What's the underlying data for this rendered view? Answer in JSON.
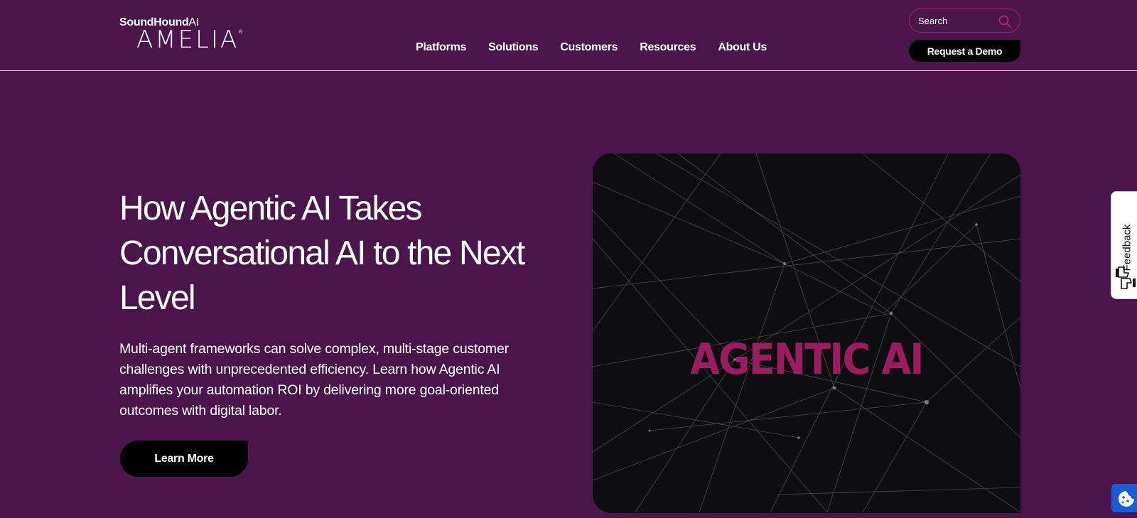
{
  "brand": {
    "company": "SoundHound",
    "company_suffix": "AI",
    "product": "AMELIA",
    "reg_mark": "®"
  },
  "nav": {
    "items": [
      {
        "label": "Platforms"
      },
      {
        "label": "Solutions"
      },
      {
        "label": "Customers"
      },
      {
        "label": "Resources"
      },
      {
        "label": "About Us"
      }
    ]
  },
  "search": {
    "placeholder": "Search",
    "icon": "search-icon"
  },
  "header": {
    "demo_label": "Request a Demo"
  },
  "hero": {
    "title": "How Agentic AI Takes Conversational AI to the Next Level",
    "description": "Multi-agent frameworks can solve complex, multi-stage customer challenges with unprecedented efficiency. Learn how Agentic AI amplifies your automation ROI by delivering more goal-oriented outcomes with digital labor.",
    "cta_label": "Learn More",
    "image_text": "AGENTIC AI"
  },
  "feedback": {
    "label": "Feedback",
    "icon": "thumbs-icon"
  },
  "cookie": {
    "icon": "cookie-icon"
  },
  "colors": {
    "background": "#4a154b",
    "accent": "#9c1d5f",
    "button": "#000000",
    "cookie_button": "#1a5bd6"
  }
}
